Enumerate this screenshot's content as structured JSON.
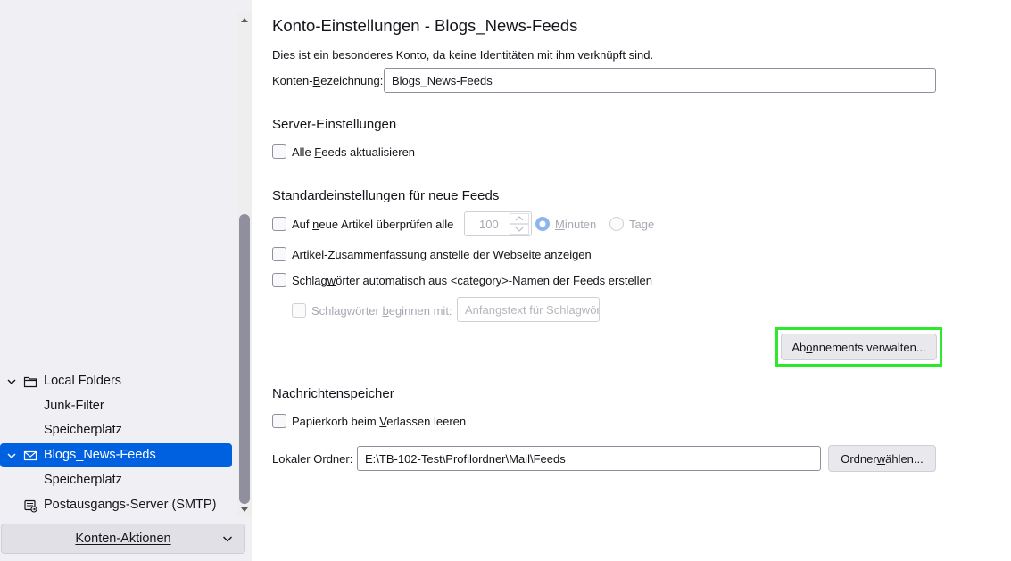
{
  "sidebar": {
    "items": [
      {
        "label": "Local Folders"
      },
      {
        "label": "Junk-Filter"
      },
      {
        "label": "Speicherplatz"
      },
      {
        "label": "Blogs_News-Feeds"
      },
      {
        "label": "Speicherplatz"
      },
      {
        "label": "Postausgangs-Server (SMTP)"
      }
    ],
    "account_actions": "Konten-Aktionen"
  },
  "main": {
    "title": "Konto-Einstellungen - Blogs_News-Feeds",
    "description": "Dies ist ein besonderes Konto, da keine Identitäten mit ihm verknüpft sind.",
    "account_name_label_pre": "Konten-",
    "account_name_label_u": "B",
    "account_name_label_post": "ezeichnung:",
    "account_name_value": "Blogs_News-Feeds",
    "server_section": "Server-Einstellungen",
    "update_all_pre": "Alle ",
    "update_all_u": "F",
    "update_all_post": "eeds aktualisieren",
    "defaults_section": "Standardeinstellungen für neue Feeds",
    "check_new_pre": "Auf ",
    "check_new_u": "n",
    "check_new_post": "eue Artikel überprüfen alle",
    "check_interval": "100",
    "unit_minutes_u": "M",
    "unit_minutes_post": "inuten",
    "unit_days_pre": "Ta",
    "unit_days_u": "g",
    "unit_days_post": "e",
    "summary_u": "A",
    "summary_post": "rtikel-Zusammenfassung anstelle der Webseite anzeigen",
    "tags_pre": "Schlag",
    "tags_u": "w",
    "tags_post": "örter automatisch aus <category>-Namen der Feeds erstellen",
    "tags_prefix_pre": "Schlagwörter ",
    "tags_prefix_u": "b",
    "tags_prefix_post": "eginnen mit:",
    "tags_prefix_placeholder": "Anfangstext für Schlagwörter",
    "manage_subs_pre": "Ab",
    "manage_subs_u": "o",
    "manage_subs_post": "nnements verwalten...",
    "storage_section": "Nachrichtenspeicher",
    "empty_trash_pre": "Papierkorb beim ",
    "empty_trash_u": "V",
    "empty_trash_post": "erlassen leeren",
    "local_dir_label": "Lokaler Ordner:",
    "local_dir_value": "E:\\TB-102-Test\\Profilordner\\Mail\\Feeds",
    "choose_dir_pre": "Ordner ",
    "choose_dir_u": "w",
    "choose_dir_post": "ählen..."
  },
  "colors": {
    "selected": "#0061e0",
    "highlight": "#2ee82e"
  }
}
